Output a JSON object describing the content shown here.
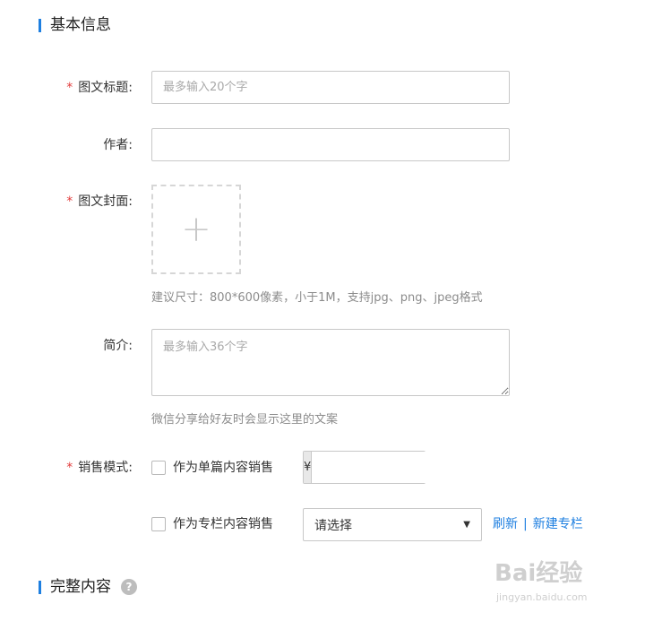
{
  "sections": {
    "basic_info": "基本信息",
    "full_content": "完整内容"
  },
  "fields": {
    "title": {
      "label": "图文标题:",
      "required": "*",
      "placeholder": "最多输入20个字",
      "value": ""
    },
    "author": {
      "label": "作者:",
      "value": ""
    },
    "cover": {
      "label": "图文封面:",
      "required": "*",
      "plus": "+",
      "hint": "建议尺寸：800*600像素，小于1M，支持jpg、png、jpeg格式"
    },
    "intro": {
      "label": "简介:",
      "placeholder": "最多输入36个字",
      "hint": "微信分享给好友时会显示这里的文案"
    },
    "sales_mode": {
      "label": "销售模式:",
      "required": "*",
      "single": {
        "label": "作为单篇内容销售",
        "currency": "¥",
        "price": ""
      },
      "column": {
        "label": "作为专栏内容销售",
        "select_value": "请选择",
        "refresh": "刷新",
        "separator": "|",
        "new_column": "新建专栏"
      }
    }
  },
  "help_icon": "?",
  "watermark": {
    "brand": "Bai经验",
    "url": "jingyan.baidu.com"
  }
}
